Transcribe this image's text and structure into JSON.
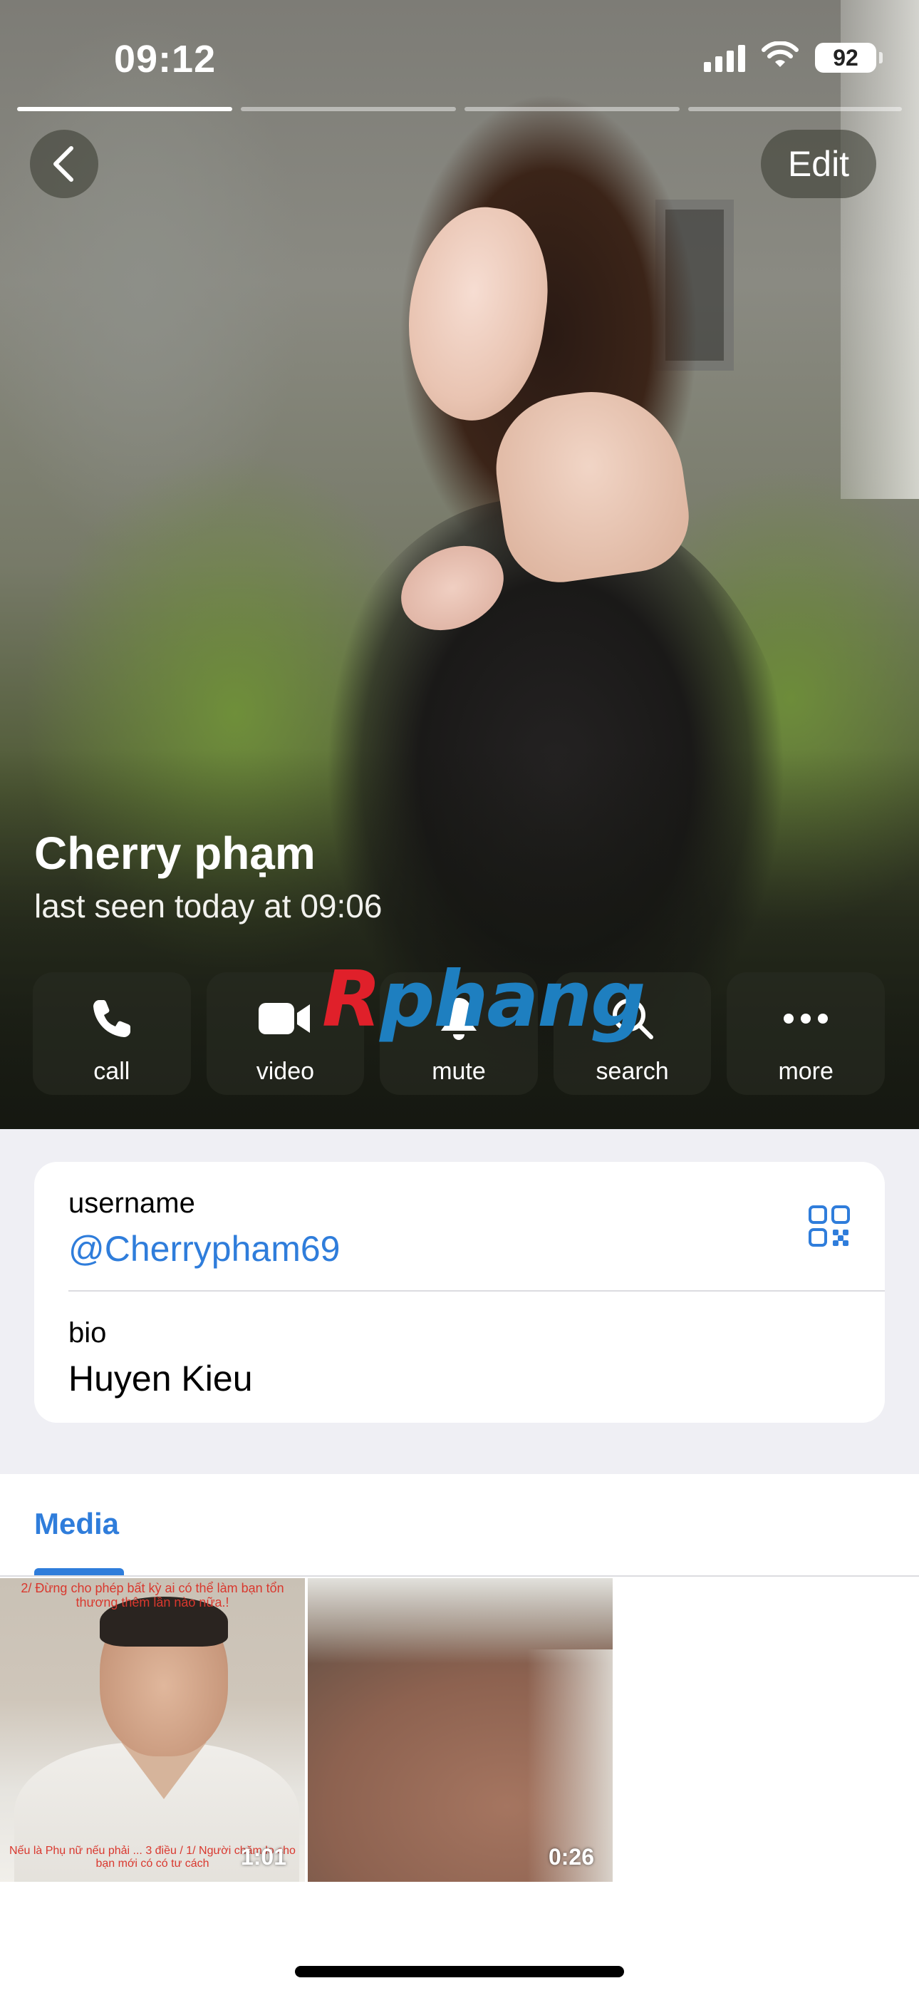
{
  "status_bar": {
    "time": "09:12",
    "battery": "92"
  },
  "story_progress": {
    "count": 4,
    "active_index": 0
  },
  "header": {
    "edit_label": "Edit"
  },
  "profile": {
    "name": "Cherry phạm",
    "last_seen": "last seen today at 09:06"
  },
  "actions": [
    {
      "label": "call",
      "icon": "phone-icon"
    },
    {
      "label": "video",
      "icon": "video-camera-icon"
    },
    {
      "label": "mute",
      "icon": "bell-icon"
    },
    {
      "label": "search",
      "icon": "search-icon"
    },
    {
      "label": "more",
      "icon": "more-dots-icon"
    }
  ],
  "watermark": {
    "first": "R",
    "rest": "phang"
  },
  "info": {
    "username_label": "username",
    "username_value": "@Cherrypham69",
    "bio_label": "bio",
    "bio_value": "Huyen Kieu"
  },
  "media": {
    "tab_label": "Media",
    "items": [
      {
        "duration": "1:01",
        "overlay_top": "2/ Đừng cho phép bất kỳ ai có thể làm bạn tổn thương thêm lần nào nữa.!",
        "overlay_bottom": "Nếu là Phụ nữ nếu phải ... 3 điều / 1/ Người chăm lo cho bạn mới có có tư cách"
      },
      {
        "duration": "0:26"
      }
    ]
  },
  "colors": {
    "accent": "#2f7ddb",
    "info_background": "#efeff4",
    "watermark_red": "#e0202a",
    "watermark_blue": "#1e7fc0"
  }
}
